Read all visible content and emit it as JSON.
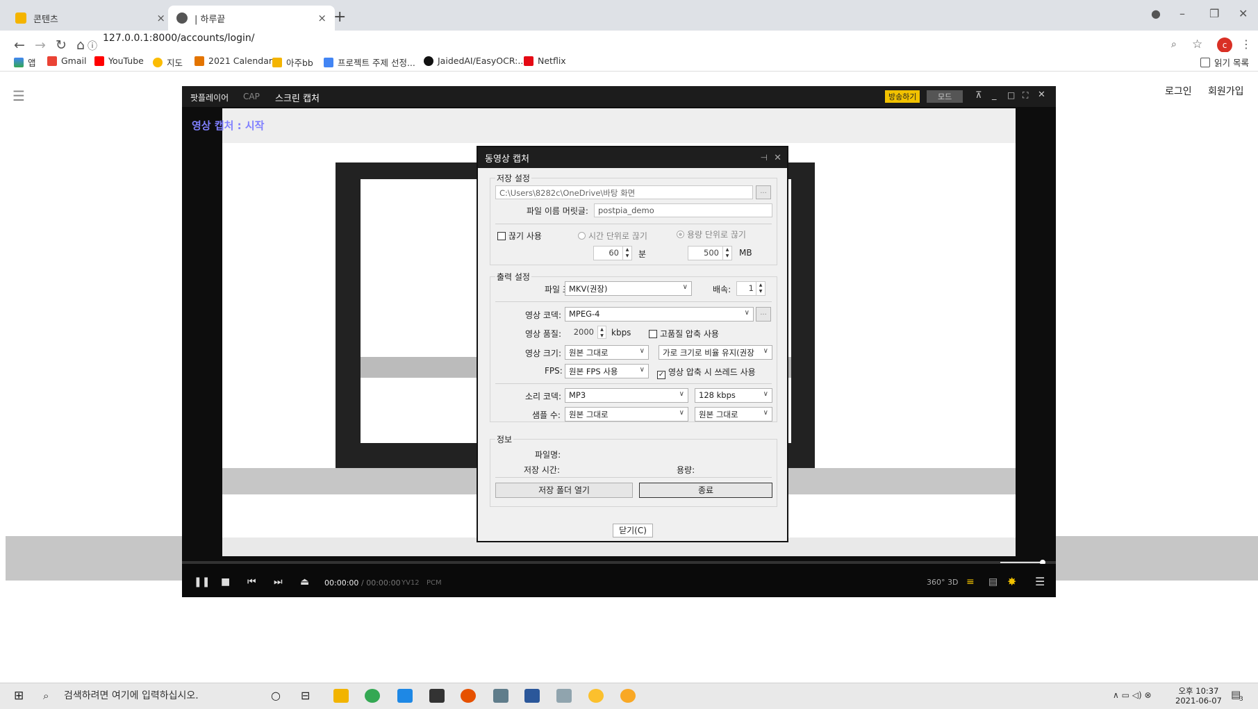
{
  "browser": {
    "tabs": [
      {
        "title": "콘텐츠",
        "close": "×"
      },
      {
        "title": "| 하루끝",
        "close": "×"
      }
    ],
    "new_tab": "+",
    "url": "127.0.0.1:8000/accounts/login/",
    "bookmarks": [
      "앱",
      "Gmail",
      "YouTube",
      "지도",
      "2021 Calendar",
      "아주bb",
      "프로젝트 주제 선정...",
      "JaidedAI/EasyOCR:...",
      "Netflix"
    ],
    "reading_list": "읽기 목록",
    "profile_initial": "c"
  },
  "page": {
    "login": "로그인",
    "signup": "회원가입"
  },
  "player": {
    "brand": "팟플레이어",
    "cap": "CAP",
    "title": "스크린 캡처",
    "broadcast": "방송하기",
    "mode": "모드",
    "capture_status": "영상 캡처 : 시작",
    "time_current": "00:00:00",
    "time_total": "/ 00:00:00",
    "format_tags": [
      "YV12",
      "PCM"
    ],
    "right_tags": [
      "360°",
      "3D"
    ]
  },
  "dialog": {
    "title": "동영상 캡처",
    "save_group": "저장 설정",
    "save_path": "C:\\Users\\8282c\\OneDrive\\바탕 화면",
    "browse": "...",
    "prefix_label": "파일 이름 머릿글:",
    "prefix_value": "postpia_demo",
    "split_use": "끊기 사용",
    "split_time": "시간 단위로 끊기",
    "split_size": "용량 단위로 끊기",
    "split_minutes": "60",
    "minutes_unit": "분",
    "split_mb": "500",
    "mb_unit": "MB",
    "output_group": "출력 설정",
    "format_label": "파일 포맷:",
    "format_value": "MKV(권장)",
    "speed_label": "배속:",
    "speed_value": "1",
    "vcodec_label": "영상 코덱:",
    "vcodec_value": "MPEG-4",
    "vquality_label": "영상 품질:",
    "vquality_value": "2000",
    "kbps_unit": "kbps",
    "hq_compress": "고품질 압축 사용",
    "vsize_label": "영상 크기:",
    "vsize_value": "원본 그대로",
    "aspect_value": "가로 크기로 비율 유지(권장",
    "fps_label": "FPS:",
    "fps_value": "원본 FPS 사용",
    "thread_compress": "영상 압축 시 쓰레드 사용",
    "acodec_label": "소리 코덱:",
    "acodec_value": "MP3",
    "abitrate_value": "128 kbps",
    "samplerate_label": "샘플 수:",
    "samplerate_value": "원본 그대로",
    "channels_value": "원본 그대로",
    "info_group": "정보",
    "filename_label": "파일명:",
    "savetime_label": "저장 시간:",
    "size_label": "용량:",
    "open_folder": "저장 폴더 열기",
    "stop": "종료",
    "close": "닫기(C)"
  },
  "taskbar": {
    "search_placeholder": "검색하려면 여기에 입력하십시오.",
    "time": "오후 10:37",
    "date": "2021-06-07",
    "notif_count": "3"
  },
  "colors": {
    "accent_yellow": "#f2c200",
    "chrome_gray": "#dee1e6",
    "dark": "#0d0d0d",
    "profile": "#d93025"
  }
}
